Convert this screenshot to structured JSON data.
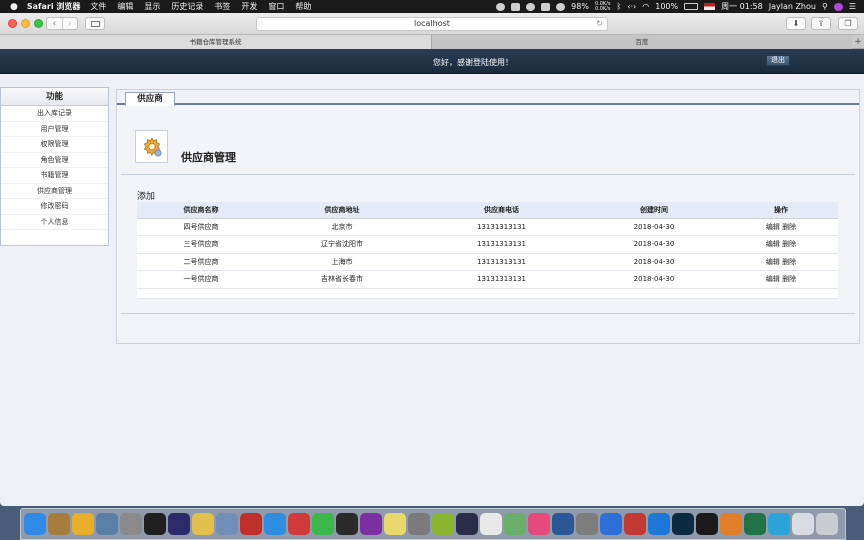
{
  "menubar": {
    "app_name": "Safari 浏览器",
    "items": [
      "文件",
      "编辑",
      "显示",
      "历史记录",
      "书签",
      "开发",
      "窗口",
      "帮助"
    ],
    "cpu_percent": "98%",
    "net_up": "0.0K/s",
    "net_down": "0.0K/s",
    "battery": "100%",
    "clock": "周一 01:58",
    "user": "Jaylan Zhou"
  },
  "browser": {
    "url": "localhost",
    "tabs": [
      {
        "label": "书籍仓库管理系统",
        "active": true
      },
      {
        "label": "百度",
        "active": false
      }
    ]
  },
  "header": {
    "welcome": "您好，感谢登陆使用！",
    "logout_label": "退出"
  },
  "sidebar": {
    "title": "功能",
    "items": [
      {
        "label": "出入库记录"
      },
      {
        "label": "用户管理"
      },
      {
        "label": "权限管理"
      },
      {
        "label": "角色管理"
      },
      {
        "label": "书籍管理"
      },
      {
        "label": "供应商管理"
      },
      {
        "label": "修改密码"
      },
      {
        "label": "个人信息"
      }
    ]
  },
  "main": {
    "tab_label": "供应商",
    "page_title": "供应商管理",
    "add_label": "添加",
    "table": {
      "columns": [
        "供应商名称",
        "供应商地址",
        "供应商电话",
        "创建时间",
        "操作"
      ],
      "rows": [
        {
          "name": "四号供应商",
          "address": "北京市",
          "phone": "13131313131",
          "created": "2018-04-30",
          "edit": "编辑",
          "delete": "删除"
        },
        {
          "name": "三号供应商",
          "address": "辽宁省沈阳市",
          "phone": "13131313131",
          "created": "2018-04-30",
          "edit": "编辑",
          "delete": "删除"
        },
        {
          "name": "二号供应商",
          "address": "上海市",
          "phone": "13131313131",
          "created": "2018-04-30",
          "edit": "编辑",
          "delete": "删除"
        },
        {
          "name": "一号供应商",
          "address": "吉林省长春市",
          "phone": "13131313131",
          "created": "2018-04-30",
          "edit": "编辑",
          "delete": "删除"
        }
      ]
    }
  },
  "dock": {
    "items": [
      {
        "icon": "finder-icon",
        "color": "#2f8ae6"
      },
      {
        "icon": "notes-book-icon",
        "color": "#a67c3d"
      },
      {
        "icon": "chrome-icon",
        "color": "#e8b02a"
      },
      {
        "icon": "preview-icon",
        "color": "#5a7fa6"
      },
      {
        "icon": "launchpad-icon",
        "color": "#8a8a8a"
      },
      {
        "icon": "intellij-icon",
        "color": "#202020"
      },
      {
        "icon": "eclipse-icon",
        "color": "#2c2a6b"
      },
      {
        "icon": "peanut-icon",
        "color": "#e0c04a"
      },
      {
        "icon": "database-icon",
        "color": "#6f8fb8"
      },
      {
        "icon": "redis-icon",
        "color": "#c0302a"
      },
      {
        "icon": "safari-icon",
        "color": "#2d8ee0"
      },
      {
        "icon": "photo-booth-icon",
        "color": "#d23a3a"
      },
      {
        "icon": "wechat-icon",
        "color": "#3bb84b"
      },
      {
        "icon": "qq-icon",
        "color": "#2a2a2a"
      },
      {
        "icon": "axure-rp-icon",
        "color": "#7b2fa0"
      },
      {
        "icon": "stickies-icon",
        "color": "#e6d96b"
      },
      {
        "icon": "sketch-icon",
        "color": "#7a7a7a"
      },
      {
        "icon": "ball-icon",
        "color": "#8ab530"
      },
      {
        "icon": "hat-icon",
        "color": "#2b2b4a"
      },
      {
        "icon": "calendar-icon",
        "color": "#e8e8e8"
      },
      {
        "icon": "maps-icon",
        "color": "#6ab06a"
      },
      {
        "icon": "itunes-icon",
        "color": "#e64a7d"
      },
      {
        "icon": "word-icon",
        "color": "#2b5797"
      },
      {
        "icon": "system-preferences-icon",
        "color": "#7d7d7d"
      },
      {
        "icon": "baidu-cloud-icon",
        "color": "#2c6fd6"
      },
      {
        "icon": "remote-desktop-icon",
        "color": "#c23a33"
      },
      {
        "icon": "teamviewer-icon",
        "color": "#1b78d6"
      },
      {
        "icon": "photoshop-icon",
        "color": "#0d2a3f"
      },
      {
        "icon": "qq-penguin-icon",
        "color": "#1a1a1a"
      },
      {
        "icon": "sublime-icon",
        "color": "#e0802a"
      },
      {
        "icon": "excel-icon",
        "color": "#217346"
      },
      {
        "icon": "browser-icon",
        "color": "#2aa4d8"
      },
      {
        "icon": "documents-folder-icon",
        "color": "#d9dde3"
      },
      {
        "icon": "trash-icon",
        "color": "#c9ccd1"
      }
    ]
  }
}
